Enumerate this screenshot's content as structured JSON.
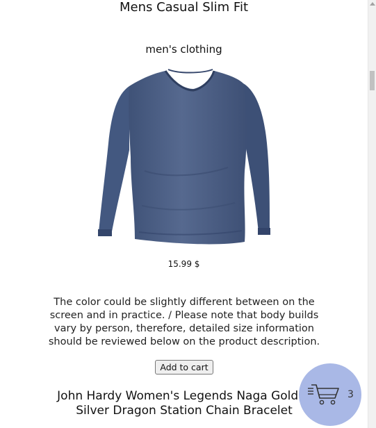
{
  "product": {
    "title": "Mens Casual Slim Fit",
    "category": "men's clothing",
    "image_icon": "long-sleeve-shirt",
    "price": "15.99 $",
    "description": "The color could be slightly different between on the screen and in practice. / Please note that body builds vary by person, therefore, detailed size information should be reviewed below on the product description.",
    "add_to_cart_label": "Add to cart"
  },
  "next_product": {
    "title": "John Hardy Women's Legends Naga Gold & Silver Dragon Station Chain Bracelet"
  },
  "cart": {
    "icon": "shopping-cart-icon",
    "count": "3",
    "background": "#a9b8e6"
  },
  "colors": {
    "shirt": "#4b5f86",
    "button_bg": "#efefef"
  }
}
